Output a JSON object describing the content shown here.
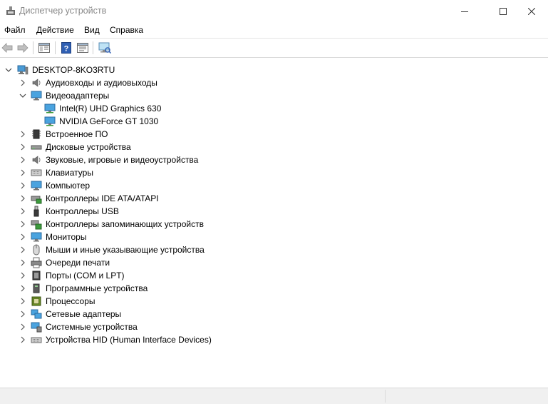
{
  "window": {
    "title": "Диспетчер устройств"
  },
  "menu": {
    "file": "Файл",
    "action": "Действие",
    "view": "Вид",
    "help": "Справка"
  },
  "tree": {
    "root": "DESKTOP-8KO3RTU",
    "categories": [
      {
        "label": "Аудиовходы и аудиовыходы",
        "icon": "speaker-icon",
        "expanded": false
      },
      {
        "label": "Видеоадаптеры",
        "icon": "monitor-icon",
        "expanded": true,
        "children": [
          "Intel(R) UHD Graphics 630",
          "NVIDIA GeForce GT 1030"
        ]
      },
      {
        "label": "Встроенное ПО",
        "icon": "chip-icon",
        "expanded": false
      },
      {
        "label": "Дисковые устройства",
        "icon": "disk-icon",
        "expanded": false
      },
      {
        "label": "Звуковые, игровые и видеоустройства",
        "icon": "speaker-icon",
        "expanded": false
      },
      {
        "label": "Клавиатуры",
        "icon": "keyboard-icon",
        "expanded": false
      },
      {
        "label": "Компьютер",
        "icon": "computer-icon",
        "expanded": false
      },
      {
        "label": "Контроллеры IDE ATA/ATAPI",
        "icon": "ide-controller-icon",
        "expanded": false
      },
      {
        "label": "Контроллеры USB",
        "icon": "usb-icon",
        "expanded": false
      },
      {
        "label": "Контроллеры запоминающих устройств",
        "icon": "storage-controller-icon",
        "expanded": false
      },
      {
        "label": "Мониторы",
        "icon": "monitor-icon",
        "expanded": false
      },
      {
        "label": "Мыши и иные указывающие устройства",
        "icon": "mouse-icon",
        "expanded": false
      },
      {
        "label": "Очереди печати",
        "icon": "printer-icon",
        "expanded": false
      },
      {
        "label": "Порты (COM и LPT)",
        "icon": "port-icon",
        "expanded": false
      },
      {
        "label": "Программные устройства",
        "icon": "software-device-icon",
        "expanded": false
      },
      {
        "label": "Процессоры",
        "icon": "processor-icon",
        "expanded": false
      },
      {
        "label": "Сетевые адаптеры",
        "icon": "network-icon",
        "expanded": false
      },
      {
        "label": "Системные устройства",
        "icon": "system-device-icon",
        "expanded": false
      },
      {
        "label": "Устройства HID (Human Interface Devices)",
        "icon": "hid-icon",
        "expanded": false
      }
    ]
  },
  "colors": {
    "accent": "#0078d7",
    "selected": "#cce8ff"
  }
}
